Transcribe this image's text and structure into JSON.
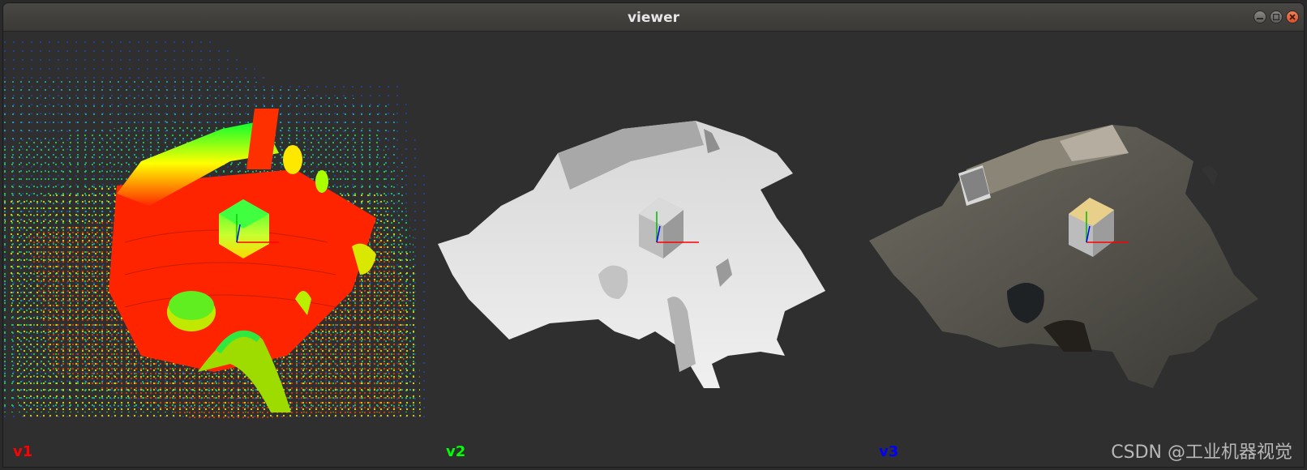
{
  "window": {
    "title": "viewer",
    "controls": [
      "minimize-icon",
      "maximize-icon",
      "close-icon"
    ]
  },
  "viewports": [
    {
      "label": "v1",
      "label_color": "#ff0000",
      "render": "height-colored point cloud",
      "colors": [
        "#ff2200",
        "#00ff33",
        "#ffff00",
        "#00cccc",
        "#1a33cc"
      ]
    },
    {
      "label": "v2",
      "label_color": "#00ff00",
      "render": "grey shaded mesh",
      "colors": [
        "#e6e6e6",
        "#bdbdbd"
      ]
    },
    {
      "label": "v3",
      "label_color": "#0000ff",
      "render": "textured mesh",
      "colors": [
        "#6d6a62",
        "#e6cf8c"
      ]
    }
  ],
  "axes_colors": {
    "x": "#ff0000",
    "y": "#00ff00",
    "z": "#0000ff"
  },
  "watermark": "CSDN @工业机器视觉"
}
